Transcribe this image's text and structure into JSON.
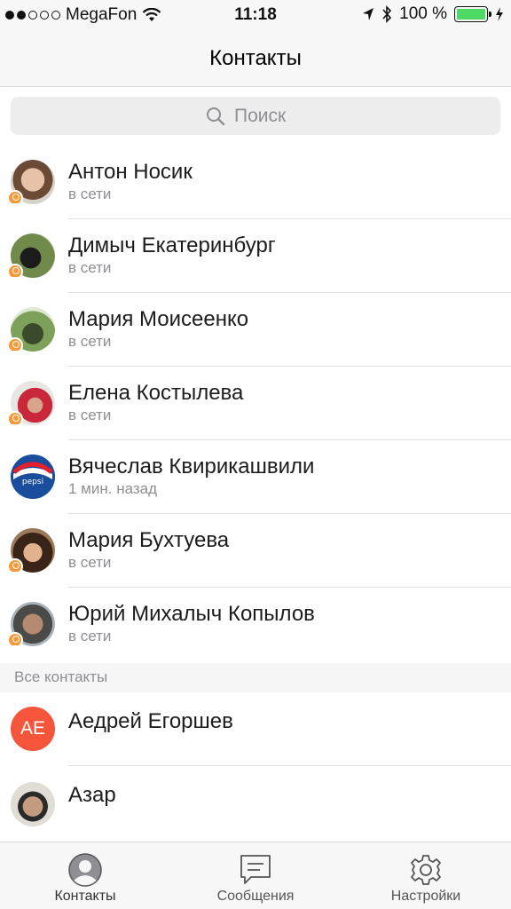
{
  "status": {
    "carrier": "MegaFon",
    "time": "11:18",
    "battery": "100 %",
    "signal_dots": [
      true,
      true,
      false,
      false,
      false
    ]
  },
  "nav": {
    "title": "Контакты"
  },
  "search": {
    "placeholder": "Поиск"
  },
  "online_contacts": [
    {
      "name": "Антон Носик",
      "status": "в сети",
      "avatar_color": "#c59c84",
      "ok": true
    },
    {
      "name": "Димыч Екатеринбург",
      "status": "в сети",
      "avatar_color": "#4a5a3a",
      "ok": true
    },
    {
      "name": "Мария Моисеенко",
      "status": "в сети",
      "avatar_color": "#6d8a58",
      "ok": true
    },
    {
      "name": "Елена Костылева",
      "status": "в сети",
      "avatar_color": "#b45060",
      "ok": true
    },
    {
      "name": "Вячеслав Квирикашвили",
      "status": "1 мин. назад",
      "avatar_color": "#1e5aa8",
      "ok": false
    },
    {
      "name": "Мария Бухтуева",
      "status": "в сети",
      "avatar_color": "#6a4a34",
      "ok": true
    },
    {
      "name": "Юрий Михалыч Копылов",
      "status": "в сети",
      "avatar_color": "#7a7a70",
      "ok": true
    }
  ],
  "all_contacts_header": "Все контакты",
  "all_contacts": [
    {
      "name": "Аедрей Егоршев",
      "initials": "AE",
      "avatar_color": "#f4553b"
    },
    {
      "name": "Азар",
      "avatar_color": "#7a6658"
    }
  ],
  "tabs": [
    {
      "label": "Контакты",
      "icon": "person-icon",
      "active": true
    },
    {
      "label": "Сообщения",
      "icon": "chat-icon",
      "active": false
    },
    {
      "label": "Настройки",
      "icon": "gear-icon",
      "active": false
    }
  ],
  "colors": {
    "accent": "#f49a3a",
    "battery": "#4cd964",
    "tab_active": "#8e8e93"
  }
}
